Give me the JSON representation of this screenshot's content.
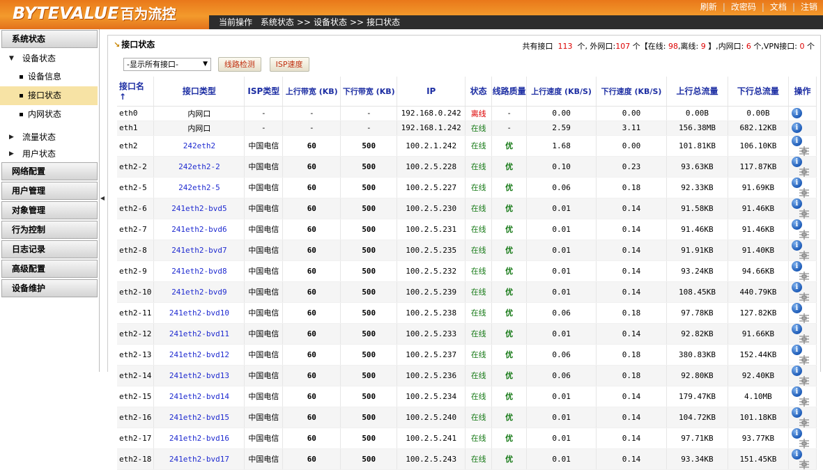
{
  "header": {
    "logo": "BYTEVALUE",
    "logo_cn": "百为流控",
    "breadcrumb": {
      "prefix": "当前操作",
      "items": [
        "系统状态",
        "设备状态",
        "接口状态"
      ],
      "separator": ">>"
    },
    "links": [
      "刷新",
      "改密码",
      "文档",
      "注销"
    ]
  },
  "sidebar": {
    "system_status": "系统状态",
    "device_status": "设备状态",
    "device_children": [
      "设备信息",
      "接口状态",
      "内网状态"
    ],
    "active_item": "接口状态",
    "traffic_status": "流量状态",
    "user_status": "用户状态",
    "groups": [
      "网络配置",
      "用户管理",
      "对象管理",
      "行为控制",
      "日志记录",
      "高级配置",
      "设备维护"
    ]
  },
  "panel": {
    "title": "接口状态",
    "stats": {
      "total_label": "共有接口",
      "total": "113",
      "unit": "个",
      "external_label": "外网口:",
      "external": "107",
      "online_label": "在线:",
      "online": "98",
      "offline_label": "离线:",
      "offline": "9",
      "internal_label": "内网口:",
      "internal": "6",
      "vpn_label": "VPN接口:",
      "vpn": "0"
    },
    "select_value": "-显示所有接口-",
    "btn_line_check": "线路检测",
    "btn_isp_speed": "ISP速度"
  },
  "table": {
    "columns": [
      "接口名",
      "接口类型",
      "ISP类型",
      "上行带宽 (KB)",
      "下行带宽 (KB)",
      "IP",
      "状态",
      "线路质量",
      "上行速度 (KB/S)",
      "下行速度 (KB/S)",
      "上行总流量",
      "下行总流量",
      "操作"
    ],
    "sort_arrow": "↑",
    "rows": [
      {
        "name": "eth0",
        "type": "内网口",
        "isp": "-",
        "up_bw": "-",
        "down_bw": "-",
        "ip": "192.168.0.242",
        "status": "离线",
        "quality": "-",
        "up_speed": "0.00",
        "down_speed": "0.00",
        "up_total": "0.00B",
        "down_total": "0.00B",
        "sniff": false
      },
      {
        "name": "eth1",
        "type": "内网口",
        "isp": "-",
        "up_bw": "-",
        "down_bw": "-",
        "ip": "192.168.1.242",
        "status": "在线",
        "quality": "-",
        "up_speed": "2.59",
        "down_speed": "3.11",
        "up_total": "156.38MB",
        "down_total": "682.12KB",
        "sniff": false
      },
      {
        "name": "eth2",
        "type": "242eth2",
        "isp": "中国电信",
        "up_bw": "60",
        "down_bw": "500",
        "ip": "100.2.1.242",
        "status": "在线",
        "quality": "优",
        "up_speed": "1.68",
        "down_speed": "0.00",
        "up_total": "101.81KB",
        "down_total": "106.10KB",
        "sniff": true
      },
      {
        "name": "eth2-2",
        "type": "242eth2-2",
        "isp": "中国电信",
        "up_bw": "60",
        "down_bw": "500",
        "ip": "100.2.5.228",
        "status": "在线",
        "quality": "优",
        "up_speed": "0.10",
        "down_speed": "0.23",
        "up_total": "93.63KB",
        "down_total": "117.87KB",
        "sniff": true
      },
      {
        "name": "eth2-5",
        "type": "242eth2-5",
        "isp": "中国电信",
        "up_bw": "60",
        "down_bw": "500",
        "ip": "100.2.5.227",
        "status": "在线",
        "quality": "优",
        "up_speed": "0.06",
        "down_speed": "0.18",
        "up_total": "92.33KB",
        "down_total": "91.69KB",
        "sniff": true
      },
      {
        "name": "eth2-6",
        "type": "241eth2-bvd5",
        "isp": "中国电信",
        "up_bw": "60",
        "down_bw": "500",
        "ip": "100.2.5.230",
        "status": "在线",
        "quality": "优",
        "up_speed": "0.01",
        "down_speed": "0.14",
        "up_total": "91.58KB",
        "down_total": "91.46KB",
        "sniff": true
      },
      {
        "name": "eth2-7",
        "type": "241eth2-bvd6",
        "isp": "中国电信",
        "up_bw": "60",
        "down_bw": "500",
        "ip": "100.2.5.231",
        "status": "在线",
        "quality": "优",
        "up_speed": "0.01",
        "down_speed": "0.14",
        "up_total": "91.46KB",
        "down_total": "91.46KB",
        "sniff": true
      },
      {
        "name": "eth2-8",
        "type": "241eth2-bvd7",
        "isp": "中国电信",
        "up_bw": "60",
        "down_bw": "500",
        "ip": "100.2.5.235",
        "status": "在线",
        "quality": "优",
        "up_speed": "0.01",
        "down_speed": "0.14",
        "up_total": "91.91KB",
        "down_total": "91.40KB",
        "sniff": true
      },
      {
        "name": "eth2-9",
        "type": "241eth2-bvd8",
        "isp": "中国电信",
        "up_bw": "60",
        "down_bw": "500",
        "ip": "100.2.5.232",
        "status": "在线",
        "quality": "优",
        "up_speed": "0.01",
        "down_speed": "0.14",
        "up_total": "93.24KB",
        "down_total": "94.66KB",
        "sniff": true
      },
      {
        "name": "eth2-10",
        "type": "241eth2-bvd9",
        "isp": "中国电信",
        "up_bw": "60",
        "down_bw": "500",
        "ip": "100.2.5.239",
        "status": "在线",
        "quality": "优",
        "up_speed": "0.01",
        "down_speed": "0.14",
        "up_total": "108.45KB",
        "down_total": "440.79KB",
        "sniff": true
      },
      {
        "name": "eth2-11",
        "type": "241eth2-bvd10",
        "isp": "中国电信",
        "up_bw": "60",
        "down_bw": "500",
        "ip": "100.2.5.238",
        "status": "在线",
        "quality": "优",
        "up_speed": "0.06",
        "down_speed": "0.18",
        "up_total": "97.78KB",
        "down_total": "127.82KB",
        "sniff": true
      },
      {
        "name": "eth2-12",
        "type": "241eth2-bvd11",
        "isp": "中国电信",
        "up_bw": "60",
        "down_bw": "500",
        "ip": "100.2.5.233",
        "status": "在线",
        "quality": "优",
        "up_speed": "0.01",
        "down_speed": "0.14",
        "up_total": "92.82KB",
        "down_total": "91.66KB",
        "sniff": true
      },
      {
        "name": "eth2-13",
        "type": "241eth2-bvd12",
        "isp": "中国电信",
        "up_bw": "60",
        "down_bw": "500",
        "ip": "100.2.5.237",
        "status": "在线",
        "quality": "优",
        "up_speed": "0.06",
        "down_speed": "0.18",
        "up_total": "380.83KB",
        "down_total": "152.44KB",
        "sniff": true
      },
      {
        "name": "eth2-14",
        "type": "241eth2-bvd13",
        "isp": "中国电信",
        "up_bw": "60",
        "down_bw": "500",
        "ip": "100.2.5.236",
        "status": "在线",
        "quality": "优",
        "up_speed": "0.06",
        "down_speed": "0.18",
        "up_total": "92.80KB",
        "down_total": "92.40KB",
        "sniff": true
      },
      {
        "name": "eth2-15",
        "type": "241eth2-bvd14",
        "isp": "中国电信",
        "up_bw": "60",
        "down_bw": "500",
        "ip": "100.2.5.234",
        "status": "在线",
        "quality": "优",
        "up_speed": "0.01",
        "down_speed": "0.14",
        "up_total": "179.47KB",
        "down_total": "4.10MB",
        "sniff": true
      },
      {
        "name": "eth2-16",
        "type": "241eth2-bvd15",
        "isp": "中国电信",
        "up_bw": "60",
        "down_bw": "500",
        "ip": "100.2.5.240",
        "status": "在线",
        "quality": "优",
        "up_speed": "0.01",
        "down_speed": "0.14",
        "up_total": "104.72KB",
        "down_total": "101.18KB",
        "sniff": true
      },
      {
        "name": "eth2-17",
        "type": "241eth2-bvd16",
        "isp": "中国电信",
        "up_bw": "60",
        "down_bw": "500",
        "ip": "100.2.5.241",
        "status": "在线",
        "quality": "优",
        "up_speed": "0.01",
        "down_speed": "0.14",
        "up_total": "97.71KB",
        "down_total": "93.77KB",
        "sniff": true
      },
      {
        "name": "eth2-18",
        "type": "241eth2-bvd17",
        "isp": "中国电信",
        "up_bw": "60",
        "down_bw": "500",
        "ip": "100.2.5.243",
        "status": "在线",
        "quality": "优",
        "up_speed": "0.01",
        "down_speed": "0.14",
        "up_total": "93.34KB",
        "down_total": "151.45KB",
        "sniff": true
      }
    ]
  },
  "colors": {
    "header_orange": "#f39a2c",
    "online_green": "#177a17",
    "offline_red": "#d00000",
    "link_blue": "#1f2bd0",
    "header_text_blue": "#1d2ea3",
    "active_menu": "#f7e3a5"
  },
  "icons": {
    "info": "info-icon",
    "sniff": "packet-capture-icon",
    "panel_title": "arrow-icon",
    "select_caret": "caret-down-icon"
  }
}
